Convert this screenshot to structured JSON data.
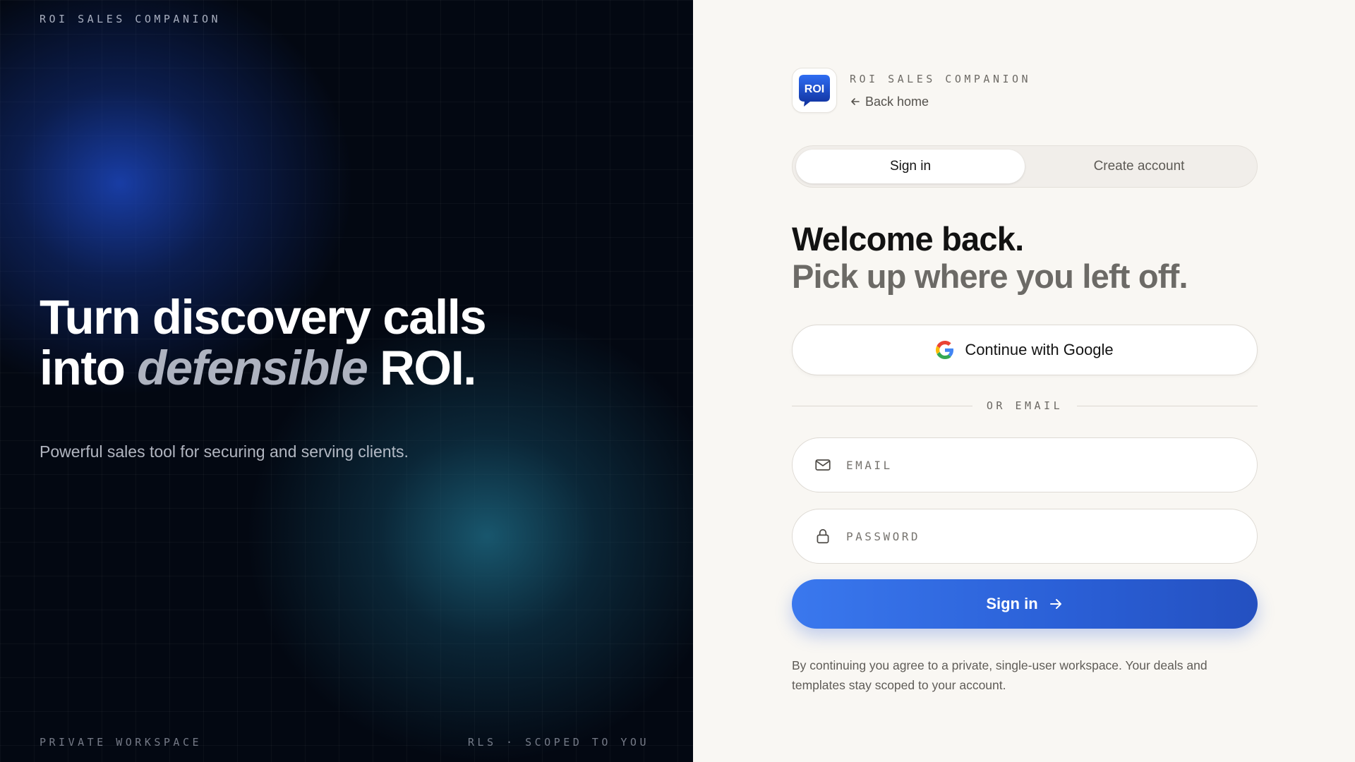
{
  "hero": {
    "brand": "ROI SALES COMPANION",
    "headline_line1": "Turn discovery calls",
    "headline_into": "into",
    "headline_emphasis": "defensible",
    "headline_end": "ROI.",
    "subtitle": "Powerful sales tool for securing and serving clients.",
    "footer_left": "PRIVATE WORKSPACE",
    "footer_right": "RLS · SCOPED TO YOU"
  },
  "panel": {
    "logo_text": "ROI",
    "brand": "ROI SALES COMPANION",
    "back_link": "Back home",
    "tabs": [
      {
        "label": "Sign in",
        "active": true
      },
      {
        "label": "Create account",
        "active": false
      }
    ],
    "heading_line1": "Welcome back.",
    "heading_line2": "Pick up where you left off.",
    "google_button": "Continue with Google",
    "divider": "OR EMAIL",
    "email": {
      "placeholder": "EMAIL",
      "value": ""
    },
    "password": {
      "placeholder": "PASSWORD",
      "value": ""
    },
    "submit": "Sign in",
    "legal": "By continuing you agree to a private, single-user workspace. Your deals and templates stay scoped to your account."
  },
  "icons": {
    "back": "arrow-left-icon",
    "google": "google-icon",
    "email": "mail-icon",
    "password": "lock-icon",
    "submit": "arrow-right-icon"
  },
  "colors": {
    "accent": "#2a5fd6",
    "hero_bg": "#030812",
    "panel_bg": "#f9f7f3",
    "hero_glow_blue": "#1c46be",
    "hero_glow_teal": "#1c647d"
  }
}
